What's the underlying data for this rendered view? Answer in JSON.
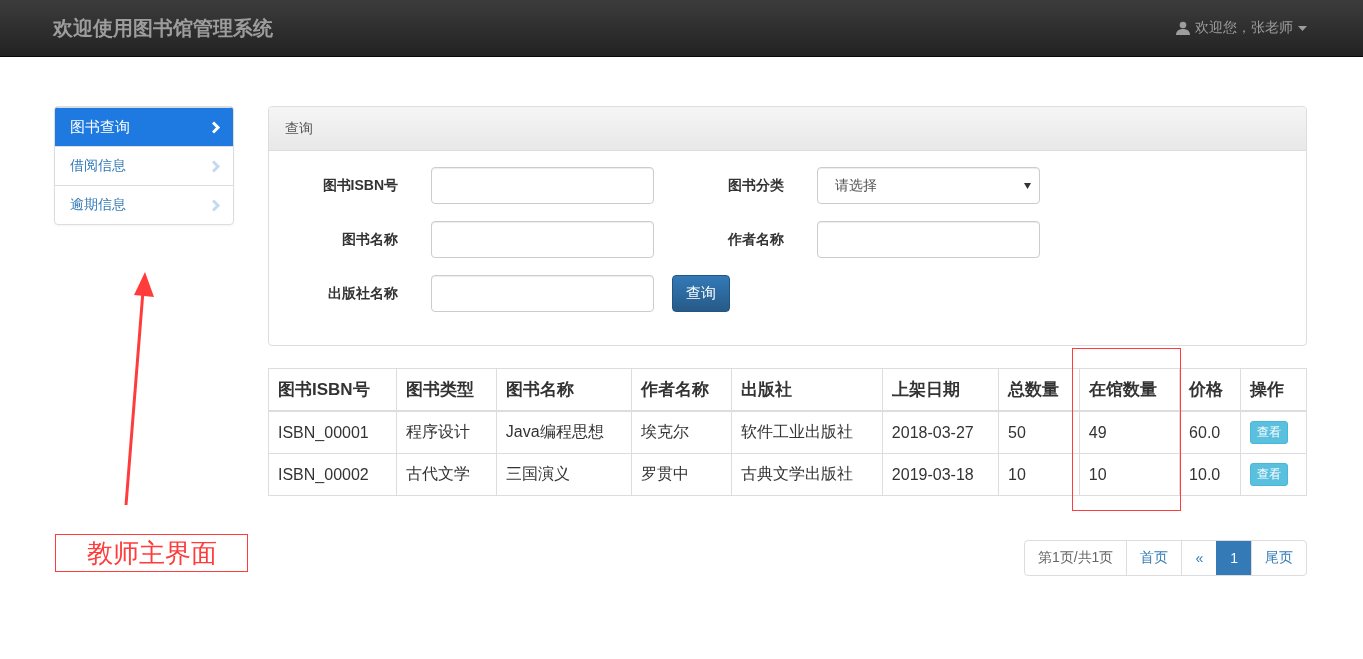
{
  "navbar": {
    "title": "欢迎使用图书馆管理系统",
    "user": "欢迎您，张老师"
  },
  "sidebar": {
    "items": [
      {
        "label": "图书查询",
        "selected": true
      },
      {
        "label": "借阅信息",
        "selected": false
      },
      {
        "label": "逾期信息",
        "selected": false
      }
    ]
  },
  "query_panel": {
    "title": "查询",
    "fields": [
      {
        "kind": "text",
        "label": "图书ISBN号"
      },
      {
        "kind": "select",
        "label": "图书分类",
        "value": "请选择"
      },
      {
        "kind": "text",
        "label": "图书名称"
      },
      {
        "kind": "text",
        "label": "作者名称"
      },
      {
        "kind": "text",
        "label": "出版社名称"
      }
    ],
    "submit": "查询"
  },
  "table": {
    "columns": [
      {
        "label": "图书ISBN号",
        "highlighted": false
      },
      {
        "label": "图书类型",
        "highlighted": false
      },
      {
        "label": "图书名称",
        "highlighted": false
      },
      {
        "label": "作者名称",
        "highlighted": false
      },
      {
        "label": "出版社",
        "highlighted": false
      },
      {
        "label": "上架日期",
        "highlighted": false
      },
      {
        "label": "总数量",
        "highlighted": false
      },
      {
        "label": "在馆数量",
        "highlighted": true
      },
      {
        "label": "价格",
        "highlighted": false
      },
      {
        "label": "操作",
        "highlighted": false
      }
    ],
    "rows": [
      {
        "cells": [
          "ISBN_00001",
          "程序设计",
          "Java编程思想",
          "埃克尔",
          "软件工业出版社",
          "2018-03-27",
          "50",
          "49",
          "60.0"
        ],
        "action": "查看"
      },
      {
        "cells": [
          "ISBN_00002",
          "古代文学",
          "三国演义",
          "罗贯中",
          "古典文学出版社",
          "2019-03-18",
          "10",
          "10",
          "10.0"
        ],
        "action": "查看"
      }
    ]
  },
  "pagination": {
    "items": [
      {
        "kind": "info",
        "label": "第1页/共1页",
        "selected": false
      },
      {
        "kind": "link",
        "label": "首页",
        "selected": false
      },
      {
        "kind": "link",
        "label": "«",
        "selected": false
      },
      {
        "kind": "link",
        "label": "1",
        "selected": true
      },
      {
        "kind": "link",
        "label": "尾页",
        "selected": false
      }
    ]
  },
  "annotation": {
    "caption": "教师主界面"
  }
}
